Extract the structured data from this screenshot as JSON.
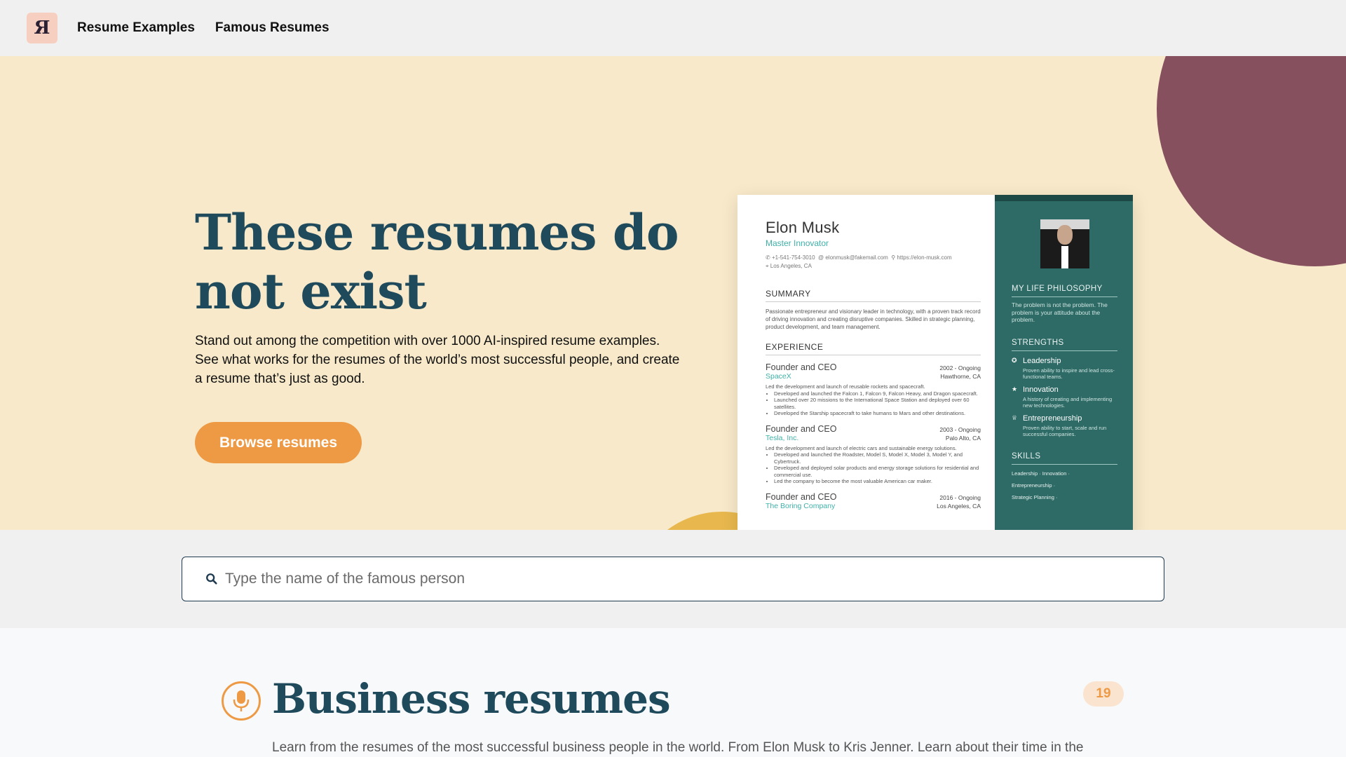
{
  "nav": {
    "logo_text": "Я",
    "links": [
      "Resume Examples",
      "Famous Resumes"
    ]
  },
  "hero": {
    "title": "These resumes do not exist",
    "subtitle": "Stand out among the competition with over 1000 AI-inspired resume examples. See what works for the resumes of the world’s most successful people, and create a resume that’s just as good.",
    "cta": "Browse resumes"
  },
  "resume": {
    "name": "Elon Musk",
    "title": "Master Innovator",
    "phone": "+1-541-754-3010",
    "email": "elonmusk@fakemail.com",
    "website": "https://elon-musk.com",
    "location": "Los Angeles, CA",
    "summary_heading": "SUMMARY",
    "summary": "Passionate entrepreneur and visionary leader in technology, with a proven track record of driving innovation and creating disruptive companies. Skilled in strategic planning, product development, and team management.",
    "experience_heading": "EXPERIENCE",
    "jobs": [
      {
        "role": "Founder and CEO",
        "dates": "2002 - Ongoing",
        "company": "SpaceX",
        "location": "Hawthorne, CA",
        "desc": "Led the development and launch of reusable rockets and spacecraft.",
        "bullets": [
          "Developed and launched the Falcon 1, Falcon 9, Falcon Heavy, and Dragon spacecraft.",
          "Launched over 20 missions to the International Space Station and deployed over 60 satellites.",
          "Developed the Starship spacecraft to take humans to Mars and other destinations."
        ]
      },
      {
        "role": "Founder and CEO",
        "dates": "2003 - Ongoing",
        "company": "Tesla, Inc.",
        "location": "Palo Alto, CA",
        "desc": "Led the development and launch of electric cars and sustainable energy solutions.",
        "bullets": [
          "Developed and launched the Roadster, Model S, Model X, Model 3, Model Y, and Cybertruck.",
          "Developed and deployed solar products and energy storage solutions for residential and commercial use.",
          "Led the company to become the most valuable American car maker."
        ]
      },
      {
        "role": "Founder and CEO",
        "dates": "2016 - Ongoing",
        "company": "The Boring Company",
        "location": "Los Angeles, CA"
      }
    ],
    "side": {
      "philosophy_heading": "MY LIFE PHILOSOPHY",
      "philosophy": "The problem is not the problem. The problem is your attitude about the problem.",
      "strengths_heading": "STRENGTHS",
      "strengths": [
        {
          "name": "Leadership",
          "desc": "Proven ability to inspire and lead cross-functional teams.",
          "icon": "award-icon"
        },
        {
          "name": "Innovation",
          "desc": "A history of creating and implementing new technologies.",
          "icon": "star-icon"
        },
        {
          "name": "Entrepreneurship",
          "desc": "Proven ability to start, scale and run successful companies.",
          "icon": "trophy-icon"
        }
      ],
      "skills_heading": "SKILLS",
      "skills": [
        "Leadership · Innovation ·",
        "Entrepreneurship ·",
        "Strategic Planning ·"
      ]
    }
  },
  "search": {
    "placeholder": "Type the name of the famous person",
    "icon": "search-icon"
  },
  "business": {
    "icon": "microphone-icon",
    "title": "Business resumes",
    "count": "19",
    "description": "Learn from the resumes of the most successful business people in the world. From Elon Musk to Kris Jenner. Learn about their time in the"
  },
  "colors": {
    "primary": "#1f4a5c",
    "accent": "#ee9a45",
    "hero_bg": "#f7e9c9",
    "circle": "#86505f",
    "resume_side": "#2e6b66"
  }
}
